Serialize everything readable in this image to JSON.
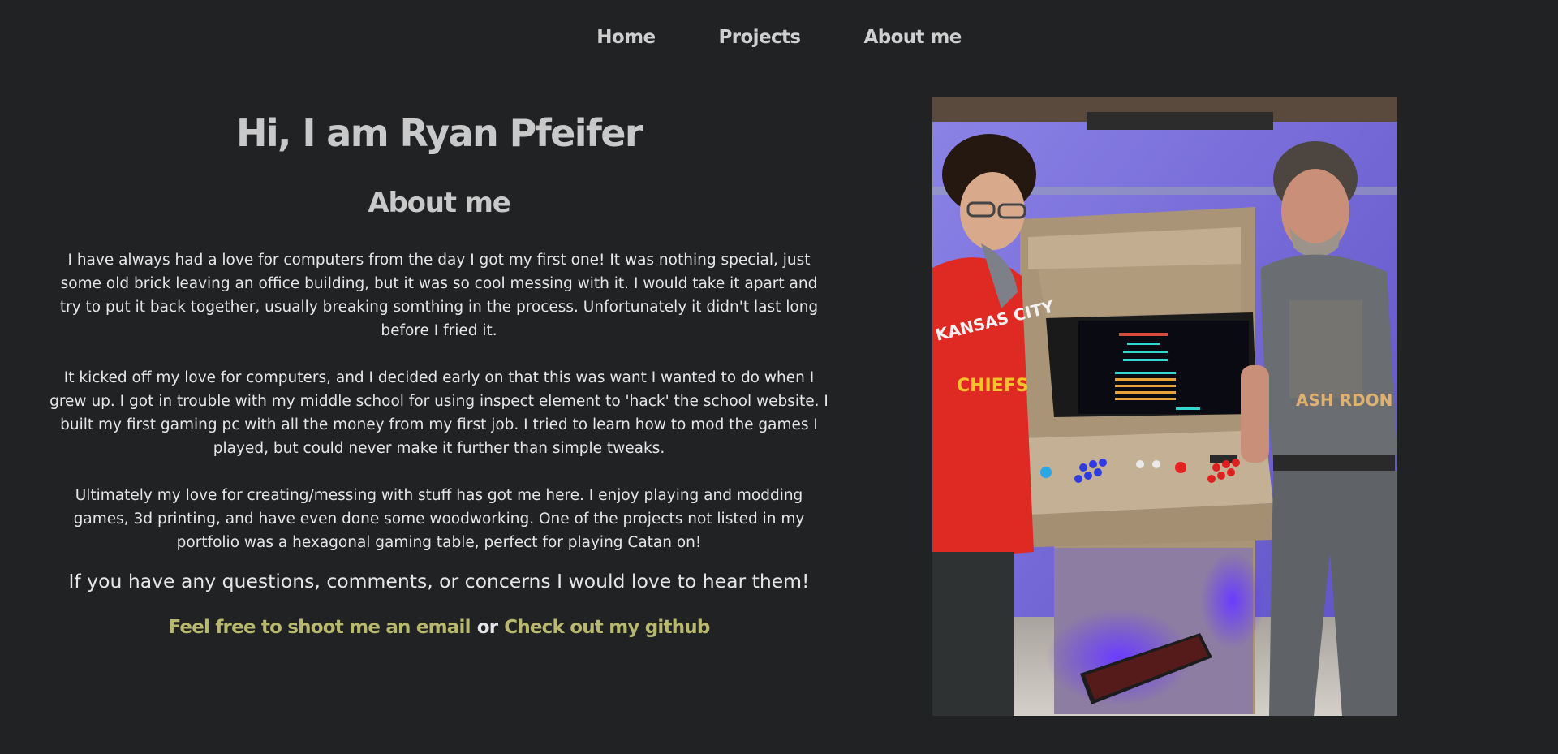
{
  "nav": {
    "items": [
      {
        "label": "Home"
      },
      {
        "label": "Projects"
      },
      {
        "label": "About me"
      }
    ]
  },
  "main": {
    "title": "Hi, I am Ryan Pfeifer",
    "subtitle": "About me",
    "paragraphs": [
      "I have always had a love for computers from the day I got my first one! It was nothing special, just some old brick leaving an office building, but it was so cool messing with it. I would take it apart and try to put it back together, usually breaking somthing in the process. Unfortunately it didn't last long before I fried it.",
      "It kicked off my love for computers, and I decided early on that this was want I wanted to do when I grew up. I got in trouble with my middle school for using inspect element to 'hack' the school website. I built my first gaming pc with all the money from my first job. I tried to learn how to mod the games I played, but could never make it further than simple tweaks.",
      "Ultimately my love for creating/messing with stuff has got me here. I enjoy playing and modding games, 3d printing, and have even done some woodworking. One of the projects not listed in my portfolio was a hexagonal gaming table, perfect for playing Catan on!"
    ],
    "cta": "If you have any questions, comments, or concerns I would love to hear them!",
    "email_link": "Feel free to shoot me an email",
    "or_text": "or",
    "github_link": "Check out my github"
  },
  "photo": {
    "hoodie_text_1": "KANSAS CITY",
    "hoodie_text_2": "CHIEFS",
    "shirt_text": "ASH RDON"
  },
  "colors": {
    "background": "#202224",
    "link_accent": "#b8b86e",
    "heading": "#c9c9c9"
  }
}
